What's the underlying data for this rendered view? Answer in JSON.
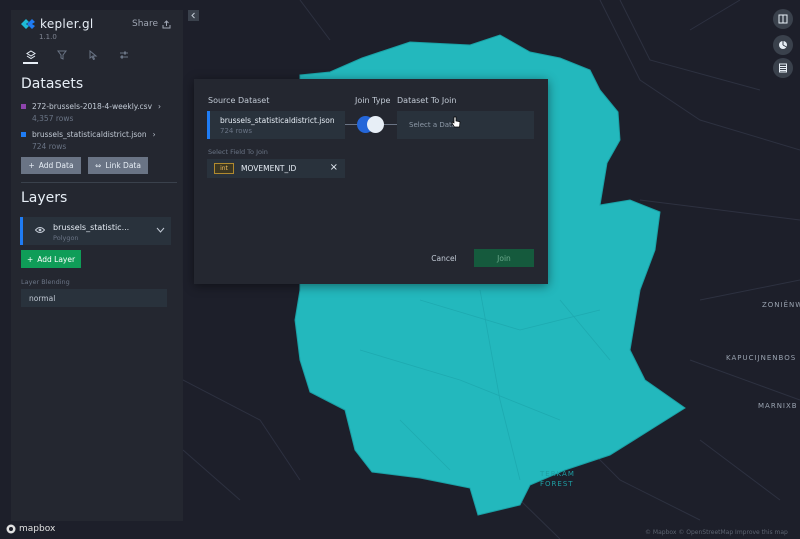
{
  "app": {
    "brand": "kepler.gl",
    "version": "1.1.0",
    "share_label": "Share"
  },
  "sidebar": {
    "datasets_title": "Datasets",
    "datasets": [
      {
        "name": "272-brussels-2018-4-weekly.csv",
        "rows": "4,357 rows",
        "color": "#8e44ad"
      },
      {
        "name": "brussels_statisticaldistrict.json",
        "rows": "724 rows",
        "color": "#1f7cf4"
      }
    ],
    "add_data_label": "Add Data",
    "link_data_label": "Link Data",
    "layers_title": "Layers",
    "layer": {
      "name": "brussels_statistic...",
      "type": "Polygon"
    },
    "add_layer_label": "Add Layer",
    "layer_blending_label": "Layer Blending",
    "layer_blending_value": "normal"
  },
  "modal": {
    "source_label": "Source Dataset",
    "join_type_label": "Join Type",
    "target_label": "Dataset To Join",
    "source": {
      "name": "brussels_statisticaldistrict.json",
      "rows": "724 rows"
    },
    "target_placeholder": "Select a Datas",
    "field_label": "Select Field To Join",
    "field_type": "int",
    "field_name": "MOVEMENT_ID",
    "remove_glyph": "×",
    "cancel_label": "Cancel",
    "join_label": "Join"
  },
  "map": {
    "labels": {
      "zonien": "ZONIËNW",
      "kapucijnen": "KAPUCIJNENBOS",
      "marnix": "MARNIXB",
      "forest1": "TERKAM",
      "forest2": "FOREST"
    },
    "attribution": "© Mapbox © OpenStreetMap Improve this map",
    "logo_text": "mapbox",
    "fill_color": "#23b8bd"
  }
}
